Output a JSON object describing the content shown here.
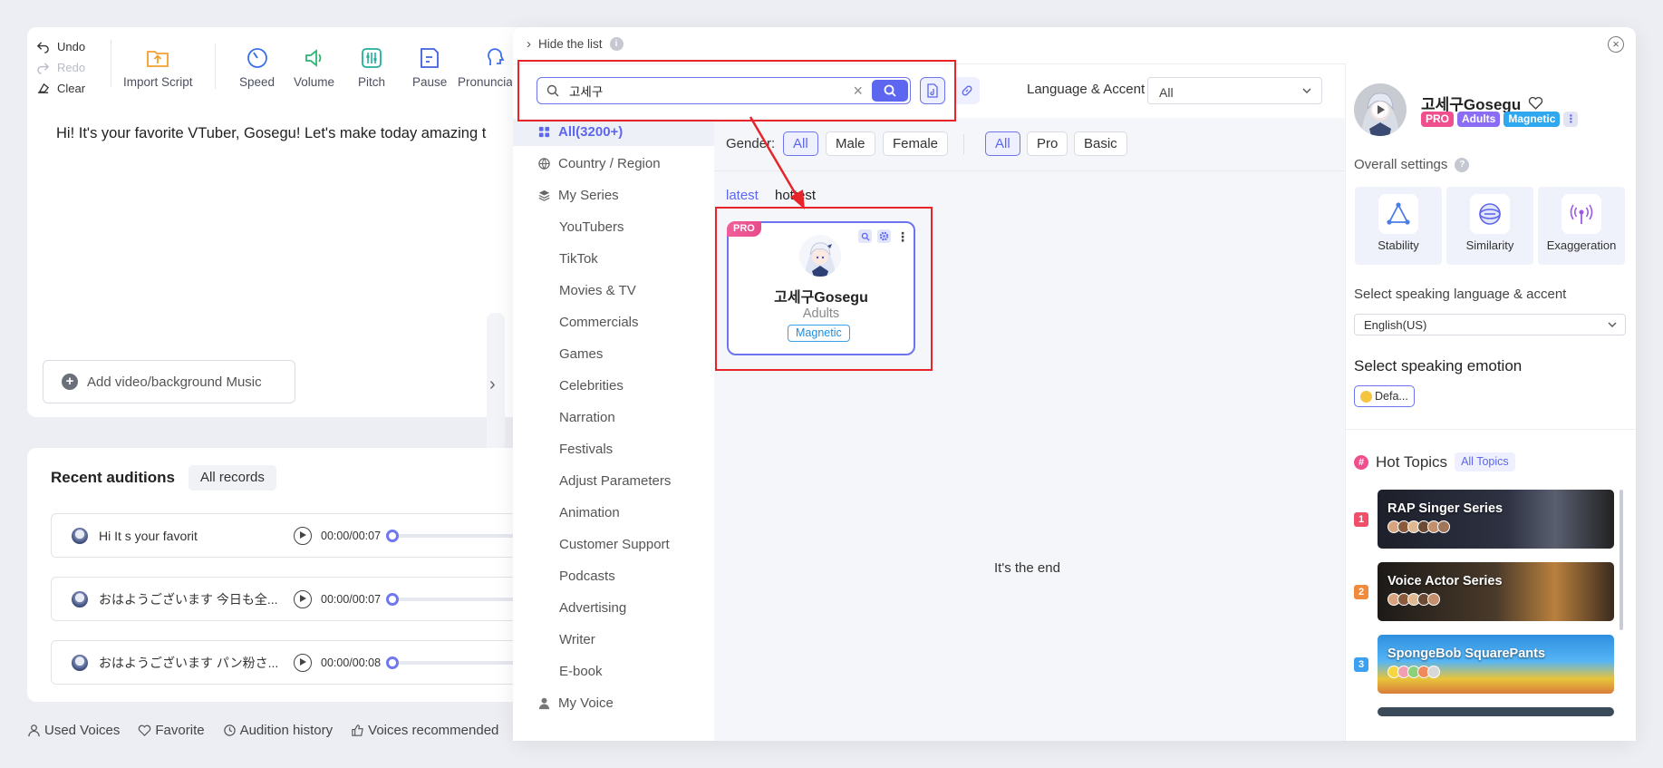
{
  "history": {
    "undo": "Undo",
    "redo": "Redo",
    "clear": "Clear"
  },
  "toolbar": {
    "import_script": "Import Script",
    "speed": "Speed",
    "volume": "Volume",
    "pitch": "Pitch",
    "pause": "Pause",
    "pronunciation": "Pronunciati"
  },
  "editor": {
    "text": "Hi! It's your favorite VTuber, Gosegu! Let's make today amazing t",
    "add_music": "Add video/background Music"
  },
  "recent": {
    "title": "Recent auditions",
    "all_records": "All records",
    "rows": [
      {
        "text": "Hi It s your favorit",
        "time": "00:00/00:07"
      },
      {
        "text": "おはようございます 今日も全...",
        "time": "00:00/00:07"
      },
      {
        "text": "おはようございます パン粉さ...",
        "time": "00:00/00:08"
      }
    ]
  },
  "bottom_bar": {
    "used_voices": "Used Voices",
    "favorite": "Favorite",
    "audition_history": "Audition history",
    "voices_recommended": "Voices recommended"
  },
  "modal": {
    "hide_list": "Hide the list",
    "search_value": "고세구",
    "language_label": "Language & Accent",
    "language_value": "All"
  },
  "categories": {
    "all": "All(3200+)",
    "country": "Country / Region",
    "series": "My Series",
    "sub": [
      "YouTubers",
      "TikTok",
      "Movies & TV",
      "Commercials",
      "Games",
      "Celebrities",
      "Narration",
      "Festivals",
      "Adjust Parameters",
      "Animation",
      "Customer Support",
      "Podcasts",
      "Advertising",
      "Writer",
      "E-book"
    ],
    "my_voice": "My Voice"
  },
  "filters": {
    "gender_label": "Gender:",
    "gender": [
      "All",
      "Male",
      "Female"
    ],
    "tier": [
      "All",
      "Pro",
      "Basic"
    ]
  },
  "sort": {
    "latest": "latest",
    "hottest": "hottest"
  },
  "voice_card": {
    "badge": "PRO",
    "name": "고세구Gosegu",
    "age": "Adults",
    "tag": "Magnetic"
  },
  "end_text": "It's the end",
  "detail": {
    "name": "고세구Gosegu",
    "tags": [
      "PRO",
      "Adults",
      "Magnetic"
    ],
    "overall_settings": "Overall settings",
    "settings": [
      "Stability",
      "Similarity",
      "Exaggeration"
    ],
    "lang_label": "Select speaking language & accent",
    "lang_value": "English(US)",
    "emotion_label": "Select speaking emotion",
    "emotion_value": "Defa...",
    "hot_topics": "Hot Topics",
    "all_topics": "All Topics",
    "topics": [
      {
        "rank": "1",
        "title": "RAP Singer Series"
      },
      {
        "rank": "2",
        "title": "Voice Actor Series"
      },
      {
        "rank": "3",
        "title": "SpongeBob SquarePants"
      }
    ]
  },
  "colors": {
    "accent": "#5d66ee",
    "annotation_red": "#e8242b",
    "pro_pink": "#ef4f8d"
  }
}
